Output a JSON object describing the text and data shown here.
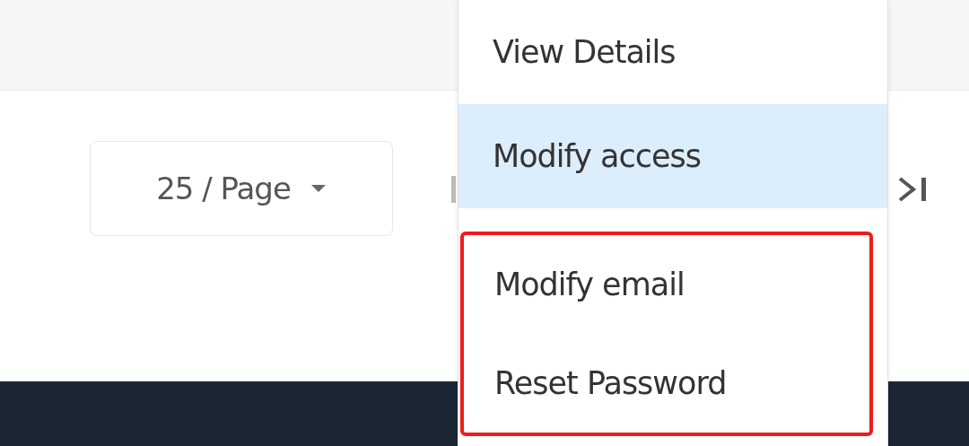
{
  "pagination": {
    "page_size": "25 / Page"
  },
  "menu": {
    "items": [
      {
        "label": "View Details",
        "selected": false,
        "boxed": false
      },
      {
        "label": "Modify access",
        "selected": true,
        "boxed": false
      },
      {
        "label": "Modify email",
        "selected": false,
        "boxed": true
      },
      {
        "label": "Reset Password",
        "selected": false,
        "boxed": true
      }
    ]
  }
}
